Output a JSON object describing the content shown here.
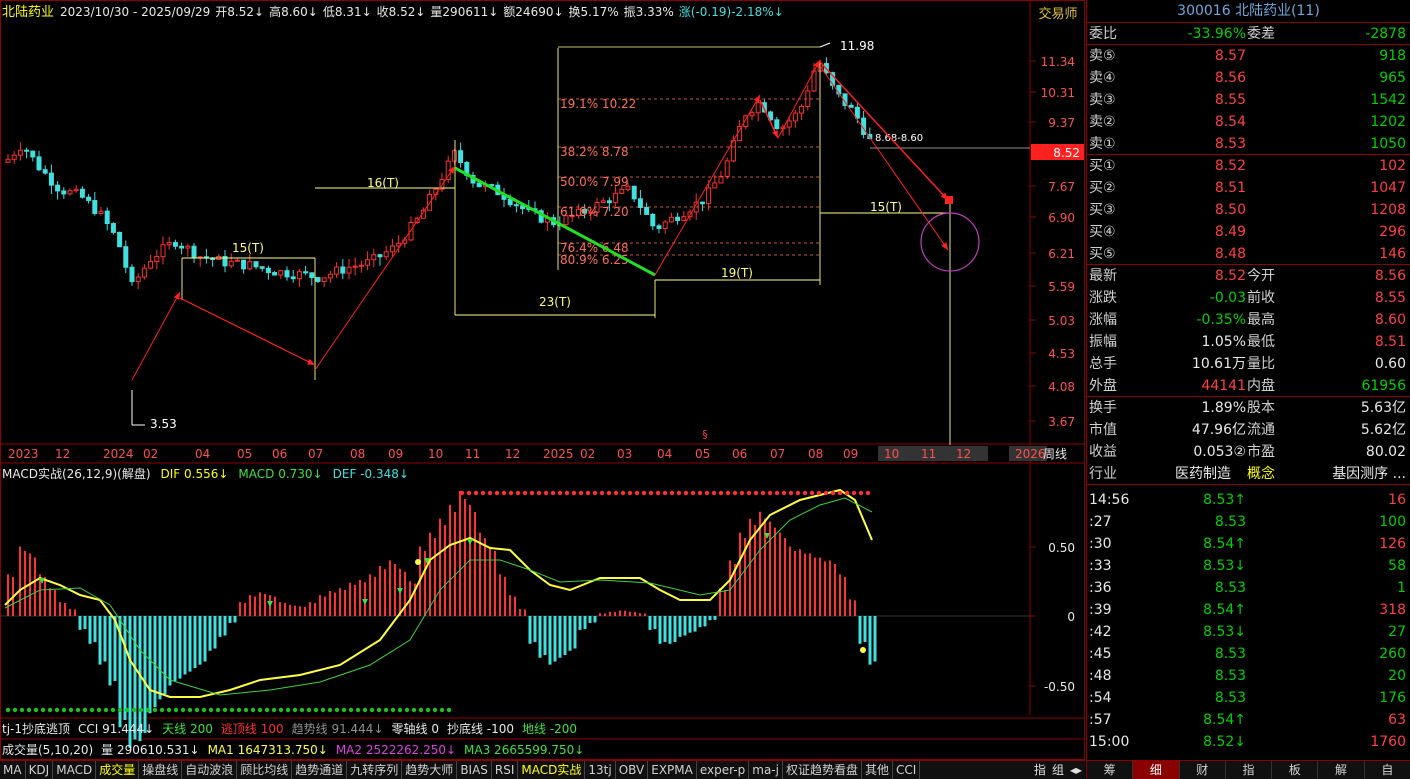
{
  "stock": {
    "name": "北陆药业",
    "code": "300016",
    "title": "300016 北陆药业(11)"
  },
  "header": {
    "range": "2023/10/30 - 2025/09/29",
    "open": "开8.52↓",
    "high": "高8.60↓",
    "low": "低8.31↓",
    "close": "收8.52↓",
    "volume": "量290611↓",
    "amount": "额24690↓",
    "turnover": "换5.17%",
    "amplitude": "振3.33%",
    "change": "涨(-0.19)-2.18%↓"
  },
  "corner": {
    "trade_label": "交易师",
    "period": "周线"
  },
  "price_axis": [
    "11.34",
    "10.31",
    "9.37",
    "8.52",
    "7.67",
    "6.90",
    "6.21",
    "5.59",
    "5.03",
    "4.53",
    "4.08",
    "3.67"
  ],
  "time_axis": [
    "2023",
    "12",
    "2024",
    "02",
    "04",
    "05",
    "06",
    "07",
    "08",
    "09",
    "10",
    "11",
    "12",
    "2025",
    "02",
    "03",
    "04",
    "05",
    "06",
    "07",
    "08",
    "09",
    "10",
    "11",
    "12",
    "2026"
  ],
  "annotations": {
    "high": "11.98",
    "low": "3.53",
    "range_label": "8.68-8.60",
    "fib": [
      "19.1% 10.22",
      "38.2% 8.78",
      "50.0% 7.99",
      "61.8% 7.20",
      "76.4% 6.48",
      "80.9% 6.25"
    ],
    "cycles": [
      "15(T)",
      "16(T)",
      "23(T)",
      "19(T)",
      "15(T)"
    ],
    "event_mark": "§"
  },
  "macd": {
    "title": "MACD实战(26,12,9)(解盘)",
    "dif": "DIF 0.556↓",
    "macd": "MACD 0.730↓",
    "def": "DEF -0.348↓",
    "axis": [
      "0.50",
      "0",
      "-0.50"
    ]
  },
  "cci_line": {
    "name": "tj-1抄底逃顶",
    "cci": "CCI 91.444↓",
    "tian": "天线 200",
    "tao": "逃顶线 100",
    "qushi": "趋势线 91.444↓",
    "zero": "零轴线 0",
    "chaodi": "抄底线 -100",
    "di": "地线 -200"
  },
  "vol_line": {
    "name": "成交量(5,10,20)",
    "vol": "量 290610.531↓",
    "ma1": "MA1 1647313.750↓",
    "ma2": "MA2 2522262.250↓",
    "ma3": "MA3 2665599.750↓"
  },
  "toolbar": [
    "MA",
    "KDJ",
    "MACD",
    "成交量",
    "操盘线",
    "自动波浪",
    "顾比均线",
    "趋势通道",
    "九转序列",
    "趋势大师",
    "BIAS",
    "RSI",
    "MACD实战",
    "13tj",
    "OBV",
    "EXPMA",
    "exper-p",
    "ma-j",
    "权证趋势看盘",
    "其他",
    "CCI"
  ],
  "toolbar_right": [
    "指",
    "组"
  ],
  "quote": {
    "wb": {
      "label": "委比",
      "value": "-33.96%",
      "label2": "委差",
      "value2": "-2878"
    },
    "asks": [
      [
        "卖⑤",
        "8.57",
        "918"
      ],
      [
        "卖④",
        "8.56",
        "965"
      ],
      [
        "卖③",
        "8.55",
        "1542"
      ],
      [
        "卖②",
        "8.54",
        "1202"
      ],
      [
        "卖①",
        "8.53",
        "1050"
      ]
    ],
    "bids": [
      [
        "买①",
        "8.52",
        "102"
      ],
      [
        "买②",
        "8.51",
        "1047"
      ],
      [
        "买③",
        "8.50",
        "1208"
      ],
      [
        "买④",
        "8.49",
        "296"
      ],
      [
        "买⑤",
        "8.48",
        "146"
      ]
    ],
    "stats": [
      [
        "最新",
        "8.52",
        "今开",
        "8.56"
      ],
      [
        "涨跌",
        "-0.03",
        "前收",
        "8.55"
      ],
      [
        "涨幅",
        "-0.35%",
        "最高",
        "8.60"
      ],
      [
        "振幅",
        "1.05%",
        "最低",
        "8.51"
      ],
      [
        "总手",
        "10.61万",
        "量比",
        "0.60"
      ],
      [
        "外盘",
        "44141",
        "内盘",
        "61956"
      ]
    ],
    "info": [
      [
        "换手",
        "1.89%",
        "股本",
        "5.63亿"
      ],
      [
        "市值",
        "47.96亿",
        "流通",
        "5.62亿"
      ],
      [
        "收益",
        "0.053②",
        "市盈",
        "80.02"
      ]
    ],
    "industry": {
      "label": "行业",
      "value": "医药制造",
      "concept_label": "概念",
      "concept": "基因测序 ..."
    }
  },
  "ticks": [
    [
      "14:56",
      "8.53↑",
      "16"
    ],
    [
      ":27",
      "8.53",
      "100"
    ],
    [
      ":30",
      "8.54↑",
      "126"
    ],
    [
      ":33",
      "8.53↓",
      "58"
    ],
    [
      ":36",
      "8.53",
      "1"
    ],
    [
      ":39",
      "8.54↑",
      "318"
    ],
    [
      ":42",
      "8.53↓",
      "27"
    ],
    [
      ":45",
      "8.53",
      "260"
    ],
    [
      ":48",
      "8.53",
      "20"
    ],
    [
      ":54",
      "8.53",
      "176"
    ],
    [
      ":57",
      "8.54↑",
      "63"
    ],
    [
      "15:00",
      "8.52↓",
      "1760"
    ]
  ],
  "side_tabs": [
    "筹",
    "细",
    "财",
    "指",
    "板",
    "解",
    "自"
  ],
  "colors": {
    "up": "#ff3030",
    "down": "#40e0e0",
    "accent_red": "#8b0000",
    "fib": "#ff7050",
    "yellow": "#ffff00"
  }
}
